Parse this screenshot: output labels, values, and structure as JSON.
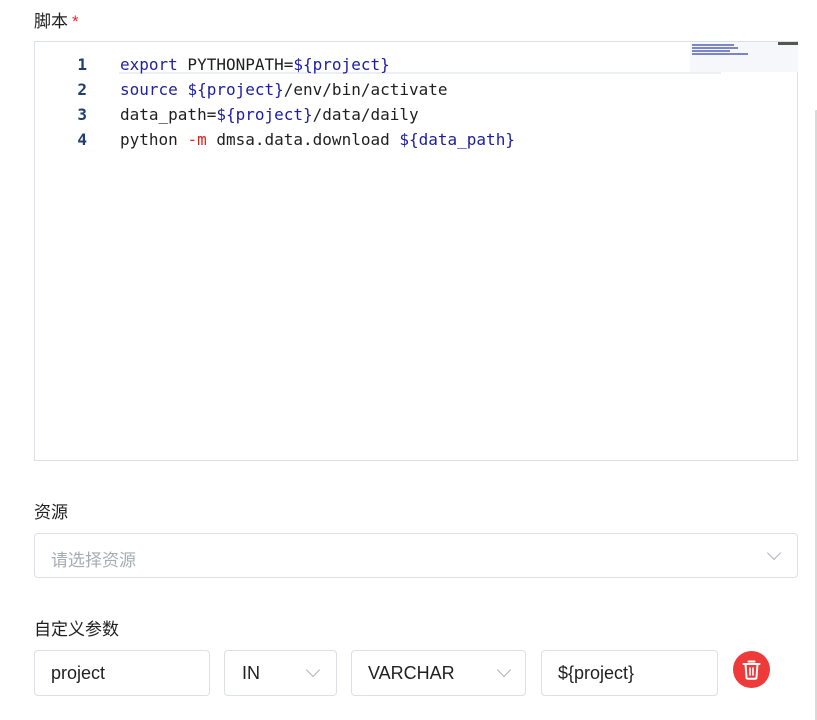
{
  "script_section": {
    "label": "脚本",
    "required_mark": "*",
    "lines": [
      {
        "num": "1",
        "tokens": [
          {
            "t": "export",
            "c": "kw"
          },
          {
            "t": " PYTHONPATH=",
            "c": "plain"
          },
          {
            "t": "${project}",
            "c": "var"
          }
        ]
      },
      {
        "num": "2",
        "tokens": [
          {
            "t": "source",
            "c": "kw"
          },
          {
            "t": " ",
            "c": "plain"
          },
          {
            "t": "${project}",
            "c": "var"
          },
          {
            "t": "/env/bin/activate",
            "c": "plain"
          }
        ]
      },
      {
        "num": "3",
        "tokens": [
          {
            "t": "data_path=",
            "c": "plain"
          },
          {
            "t": "${project}",
            "c": "var"
          },
          {
            "t": "/data/daily",
            "c": "plain"
          }
        ]
      },
      {
        "num": "4",
        "tokens": [
          {
            "t": "python ",
            "c": "plain"
          },
          {
            "t": "-m",
            "c": "flag"
          },
          {
            "t": " dmsa.data.download ",
            "c": "plain"
          },
          {
            "t": "${data_path}",
            "c": "var"
          }
        ]
      }
    ]
  },
  "resource_section": {
    "label": "资源",
    "placeholder": "请选择资源"
  },
  "params_section": {
    "label": "自定义参数",
    "param": {
      "name": "project",
      "direction": "IN",
      "type": "VARCHAR",
      "value": "${project}"
    }
  },
  "colors": {
    "keyword": "#22229a",
    "variable": "#1b1ba6",
    "flag": "#e0231c",
    "delete_button": "#ef3a3a",
    "required": "#f5222d"
  },
  "icons": {
    "select_arrow": "chevron-down-icon",
    "delete": "trash-icon"
  }
}
